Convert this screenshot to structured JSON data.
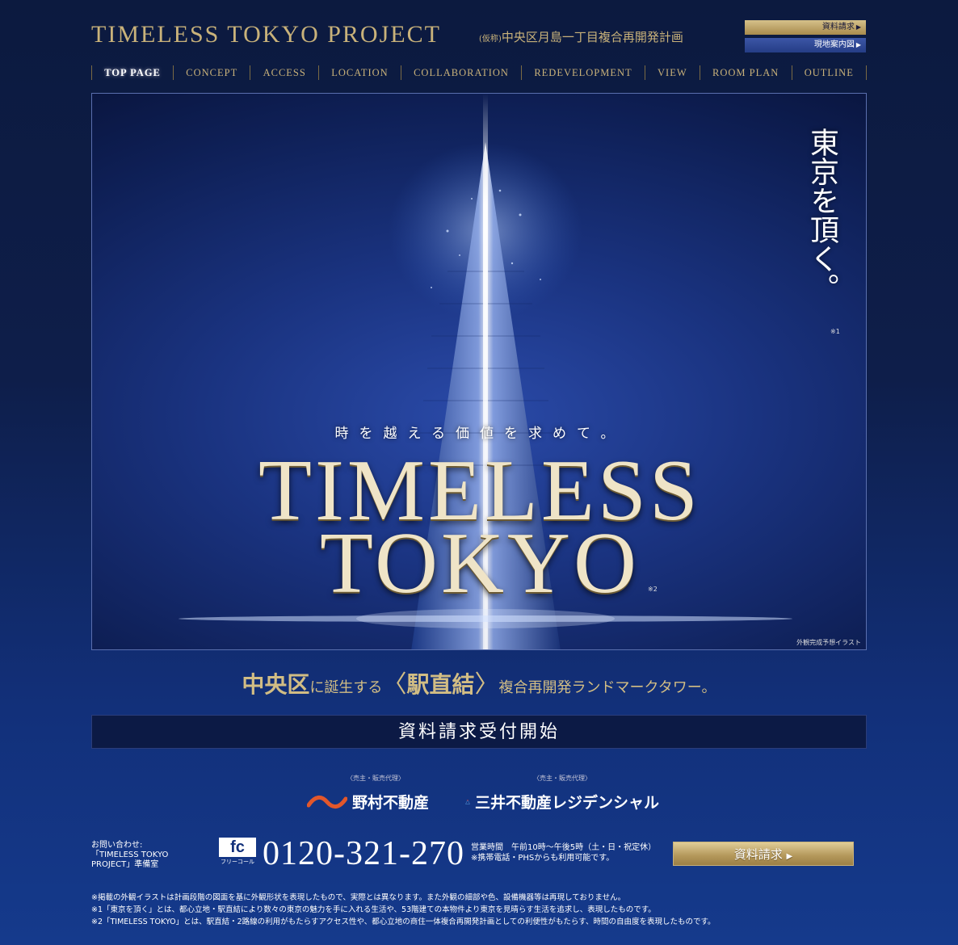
{
  "header": {
    "title": "TIMELESS TOKYO PROJECT",
    "subtitle_kana": "(仮称)",
    "subtitle": "中央区月島一丁目複合再開発計画",
    "btn_request": "資料請求",
    "btn_map": "現地案内図"
  },
  "nav": {
    "items": [
      "TOP PAGE",
      "CONCEPT",
      "ACCESS",
      "LOCATION",
      "COLLABORATION",
      "REDEVELOPMENT",
      "VIEW",
      "ROOM PLAN",
      "OUTLINE"
    ]
  },
  "hero": {
    "vertical_copy": "東京を頂く。",
    "note1": "※1",
    "catch": "時を越える価値を求めて。",
    "logo_line1": "TIMELESS",
    "logo_line2": "TOKYO",
    "note2": "※2",
    "illustration_note": "外観完成予想イラスト"
  },
  "tagline": {
    "part1": "中央区",
    "part2": "に誕生する",
    "bracket_open": "〈",
    "part3": "駅直結",
    "bracket_close": "〉",
    "part4": "複合再開発ランドマークタワー。"
  },
  "request_banner": "資料請求受付開始",
  "developers": {
    "role": "〈売主・販売代理〉",
    "nomura": "野村不動産",
    "mitsui": "三井不動産レジデンシャル"
  },
  "contact": {
    "label_line1": "お問い合わせ:",
    "label_line2": "「TIMELESS TOKYO",
    "label_line3": "PROJECT」準備室",
    "freecall_mark": "fc",
    "freecall_caption": "フリーコール",
    "phone": "0120-321-270",
    "hours_line1": "営業時間　午前10時〜午後5時（土・日・祝定休）",
    "hours_line2": "※携帯電話・PHSからも利用可能です。",
    "request_button": "資料請求"
  },
  "footnotes": {
    "n0": "※掲載の外観イラストは計画段階の図面を基に外観形状を表現したもので、実際とは異なります。また外観の細部や色、設備機器等は再現しておりません。",
    "n1": "※1「東京を頂く」とは、都心立地・駅直結により数々の東京の魅力を手に入れる生活や、53階建ての本物件より東京を見晴らす生活を追求し、表現したものです。",
    "n2": "※2「TIMELESS TOKYO」とは、駅直結・2路線の利用がもたらすアクセス性や、都心立地の商住一体複合再開発計画としての利便性がもたらす、時間の自由度を表現したものです。"
  },
  "colors": {
    "gold": "#c9b27a",
    "navy": "#0c1a3f",
    "blue": "#12307a"
  }
}
